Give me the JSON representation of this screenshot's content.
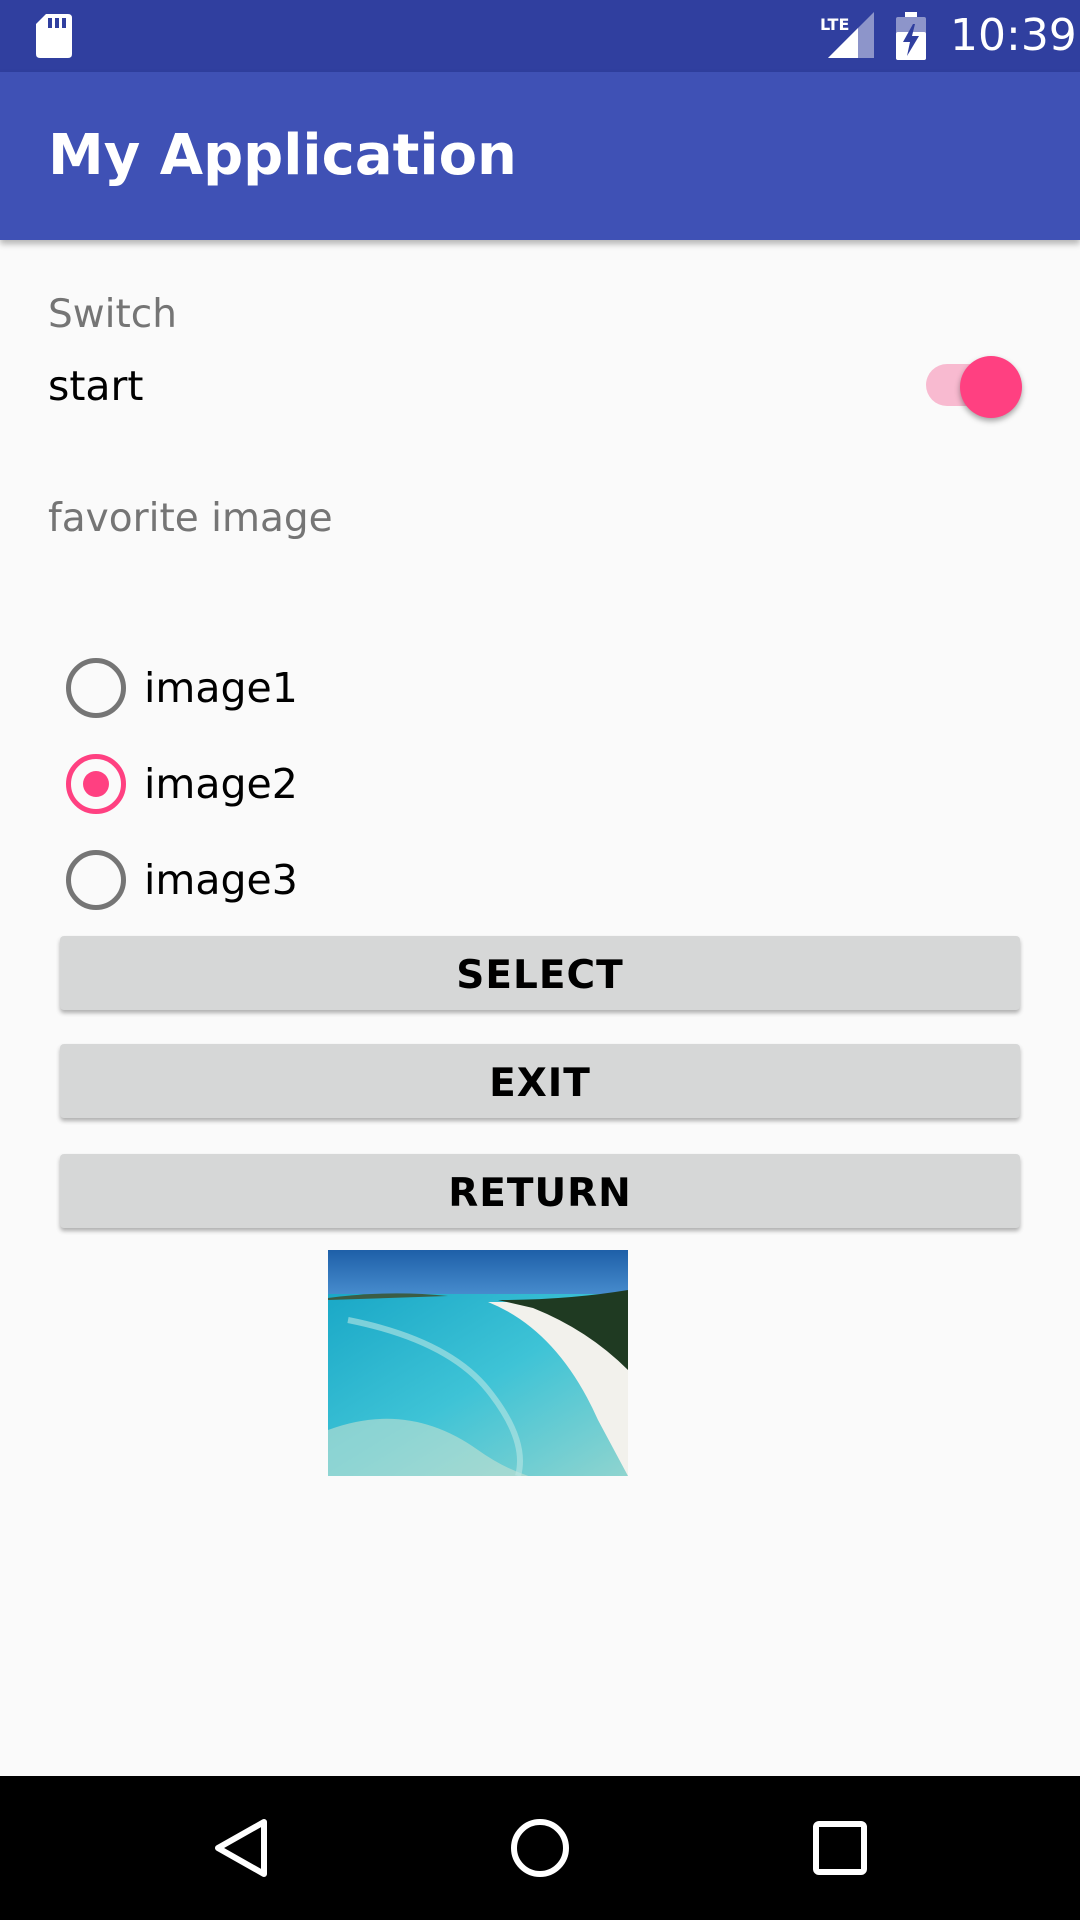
{
  "status_bar": {
    "time": "10:39",
    "network_label": "LTE",
    "icons": [
      "sd-card-icon",
      "lte-signal-icon",
      "battery-charging-icon"
    ]
  },
  "app_bar": {
    "title": "My Application",
    "color": "#3f51b5",
    "status_color": "#303f9f"
  },
  "switch_section": {
    "label": "Switch",
    "switch_text": "start",
    "checked": true
  },
  "favorite_section": {
    "label": "favorite image",
    "options": [
      {
        "label": "image1",
        "checked": false
      },
      {
        "label": "image2",
        "checked": true
      },
      {
        "label": "image3",
        "checked": false
      }
    ]
  },
  "buttons": {
    "select": "SELECT",
    "exit": "EXIT",
    "return": "RETURN"
  },
  "image": {
    "subject": "beach-photo"
  },
  "nav_bar": {
    "icons": [
      "back-icon",
      "home-icon",
      "recents-icon"
    ]
  },
  "colors": {
    "accent": "#ff4081",
    "button_bg": "#d6d7d7",
    "background": "#fafafa"
  }
}
